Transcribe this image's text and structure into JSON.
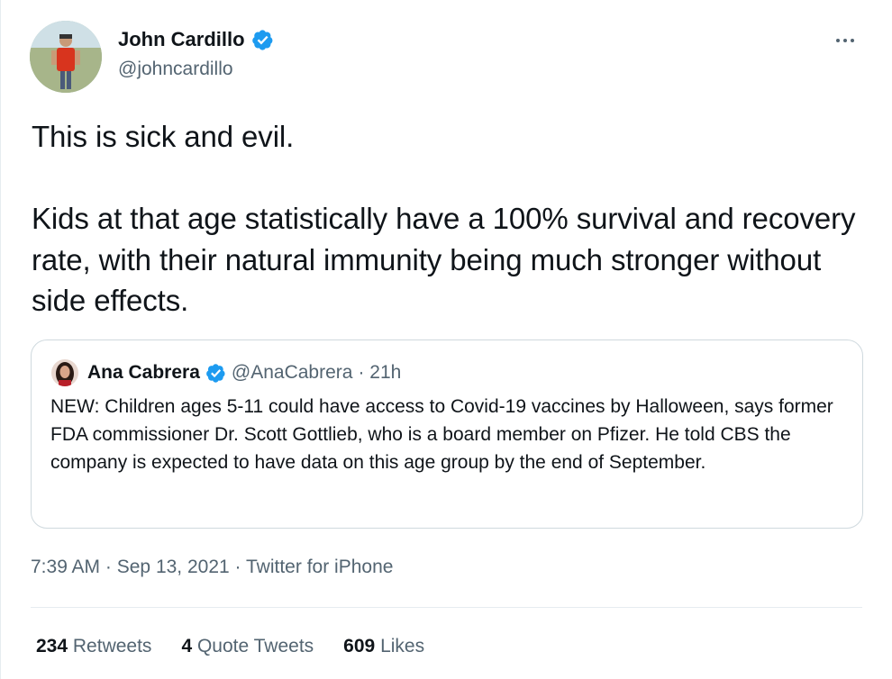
{
  "colors": {
    "verified_blue": "#1d9bf0",
    "secondary_text": "#536471",
    "primary_text": "#0f1419",
    "border": "#cfd9de"
  },
  "tweet": {
    "author": {
      "name": "John Cardillo",
      "handle": "@johncardillo",
      "verified_icon": "verified-badge-icon"
    },
    "more_icon": "more-options-icon",
    "text": "This is sick and evil.\n\nKids at that age statistically have a 100% survival and recovery rate, with their natural immunity being much stronger without side effects.",
    "quoted": {
      "author": {
        "name": "Ana Cabrera",
        "handle": "@AnaCabrera",
        "time": "· 21h",
        "verified_icon": "verified-badge-icon"
      },
      "text": "NEW: Children ages 5-11 could have access to Covid-19 vaccines by Halloween, says former FDA commissioner Dr. Scott Gottlieb, who is a board member on Pfizer. He told CBS the company is expected to have data on this age group by the end of September."
    },
    "time": "7:39 AM",
    "date": "Sep 13, 2021",
    "sep": "·",
    "source": "Twitter for iPhone",
    "stats": {
      "retweets_count": "234",
      "retweets_label": "Retweets",
      "quotes_count": "4",
      "quotes_label": "Quote Tweets",
      "likes_count": "609",
      "likes_label": "Likes"
    }
  }
}
